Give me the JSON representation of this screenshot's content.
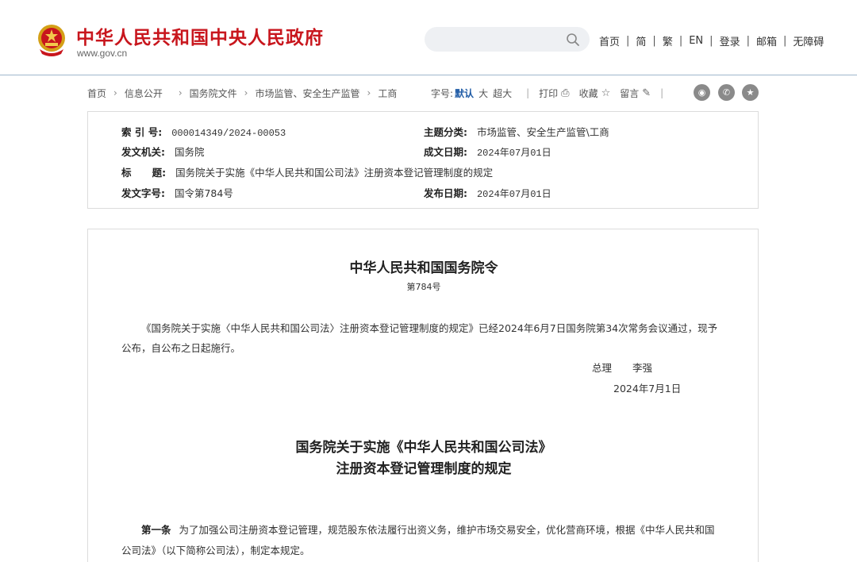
{
  "header": {
    "site_title": "中华人民共和国中央人民政府",
    "site_url": "www.gov.cn",
    "search": {
      "value": "",
      "placeholder": ""
    },
    "links": [
      "首页",
      "简",
      "繁",
      "EN",
      "登录",
      "邮箱",
      "无障碍"
    ],
    "brand_color": "#c8161d"
  },
  "breadcrumb": [
    "首页",
    "信息公开",
    "国务院文件",
    "市场监管、安全生产监管",
    "工商"
  ],
  "tools": {
    "font_label": "字号:",
    "font_sizes": [
      "默认",
      "大",
      "超大"
    ],
    "active_font": "默认",
    "print": "打印",
    "favorite": "收藏",
    "comment": "留言"
  },
  "share_icons": [
    "weibo-icon",
    "wechat-icon",
    "star-icon"
  ],
  "info": {
    "index_label": "索 引 号:",
    "index_value": "000014349/2024-00053",
    "category_label": "主题分类:",
    "category_value": "市场监管、安全生产监管\\工商",
    "issuer_label": "发文机关:",
    "issuer_value": "国务院",
    "written_label": "成文日期:",
    "written_value": "2024年07月01日",
    "title_label": "标      题:",
    "title_value": "国务院关于实施《中华人民共和国公司法》注册资本登记管理制度的规定",
    "docno_label": "发文字号:",
    "docno_value": "国令第784号",
    "published_label": "发布日期:",
    "published_value": "2024年07月01日"
  },
  "article": {
    "order_title": "中华人民共和国国务院令",
    "order_no": "第784号",
    "intro": "《国务院关于实施〈中华人民共和国公司法〉注册资本登记管理制度的规定》已经2024年6月7日国务院第34次常务会议通过，现予公布，自公布之日起施行。",
    "sign_title": "总理",
    "sign_name": "李强",
    "sign_date": "2024年7月1日",
    "reg_title_line1": "国务院关于实施《中华人民共和国公司法》",
    "reg_title_line2": "注册资本登记管理制度的规定",
    "art1_label": "第一条",
    "art1_text": "为了加强公司注册资本登记管理，规范股东依法履行出资义务，维护市场交易安全，优化营商环境，根据《中华人民共和国公司法》（以下简称公司法），制定本规定。"
  }
}
